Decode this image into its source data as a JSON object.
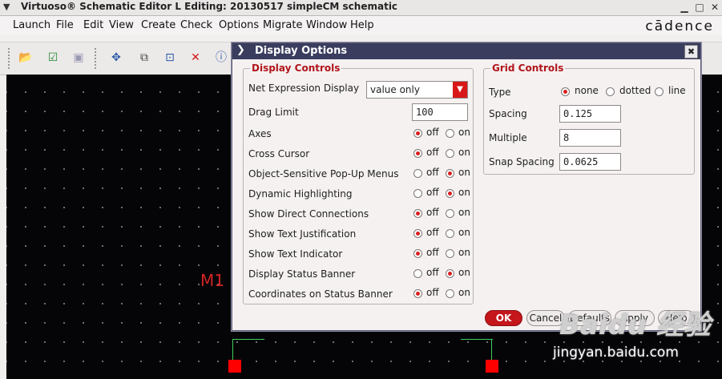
{
  "window": {
    "title": "Virtuoso® Schematic Editor L Editing: 20130517 simpleCM schematic"
  },
  "menubar": {
    "items": [
      "Launch",
      "File",
      "Edit",
      "View",
      "Create",
      "Check",
      "Options",
      "Migrate",
      "Window",
      "Help"
    ],
    "logo": "cādence"
  },
  "toolbar": {
    "icons": [
      "open-folder-icon",
      "check-save-icon",
      "save-icon",
      "move-icon",
      "copy-icon",
      "stretch-icon",
      "delete-icon",
      "info-icon"
    ]
  },
  "canvas": {
    "instance_label": "M1"
  },
  "dialog": {
    "title": "Display Options",
    "display_controls": {
      "title": "Display Controls",
      "net_expression_label": "Net Expression Display",
      "net_expression_value": "value only",
      "drag_limit_label": "Drag Limit",
      "drag_limit_value": "100",
      "toggles": [
        {
          "label": "Axes",
          "off": "off",
          "on": "on",
          "selected": "off"
        },
        {
          "label": "Cross Cursor",
          "off": "off",
          "on": "on",
          "selected": "off"
        },
        {
          "label": "Object-Sensitive Pop-Up Menus",
          "off": "off",
          "on": "on",
          "selected": "on"
        },
        {
          "label": "Dynamic Highlighting",
          "off": "off",
          "on": "on",
          "selected": "on"
        },
        {
          "label": "Show Direct Connections",
          "off": "off",
          "on": "on",
          "selected": "off"
        },
        {
          "label": "Show Text Justification",
          "off": "off",
          "on": "on",
          "selected": "off"
        },
        {
          "label": "Show Text Indicator",
          "off": "off",
          "on": "on",
          "selected": "off"
        },
        {
          "label": "Display Status Banner",
          "off": "off",
          "on": "on",
          "selected": "on"
        },
        {
          "label": "Coordinates on Status Banner",
          "off": "off",
          "on": "on",
          "selected": "off"
        }
      ]
    },
    "grid_controls": {
      "title": "Grid Controls",
      "type_label": "Type",
      "type_options": [
        "none",
        "dotted",
        "line"
      ],
      "type_selected": "none",
      "spacing_label": "Spacing",
      "spacing_value": "0.125",
      "multiple_label": "Multiple",
      "multiple_value": "8",
      "snap_label": "Snap Spacing",
      "snap_value": "0.0625"
    },
    "buttons": {
      "ok": "OK",
      "cancel": "Cancel",
      "defaults": "Defaults",
      "apply": "Apply",
      "help": "Help"
    }
  },
  "watermark": {
    "logo": "Baidu 经验",
    "url": "jingyan.baidu.com"
  },
  "colors": {
    "dialog_title_bg": "#3a3d5e",
    "group_title": "#b1151a",
    "ok_button": "#c4161b",
    "radio_selected": "#d81f1f",
    "canvas_bg": "#050508",
    "pin": "#ff0000",
    "wire": "#3fcf5a"
  }
}
